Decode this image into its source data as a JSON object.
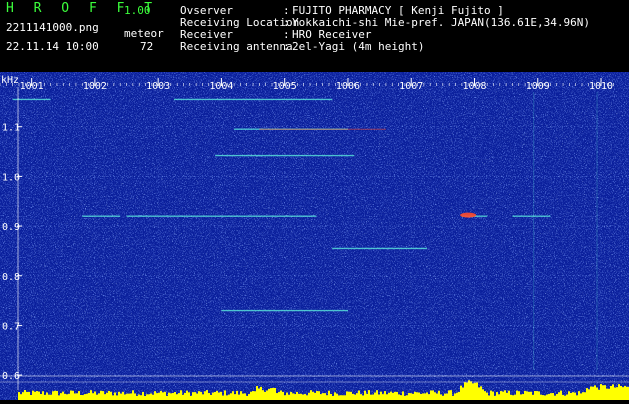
{
  "header": {
    "app_title": "H R O F F T",
    "version": "1.00",
    "filename": "2211141000.png",
    "datetime": "22.11.14 10:00",
    "meteor_label": "meteor",
    "meteor_count": "72",
    "fields": [
      {
        "label": "Ovserver",
        "value": "FUJITO PHARMACY [ Kenji Fujito ]"
      },
      {
        "label": "Receiving Location",
        "value": "Yokkaichi-shi Mie-pref. JAPAN(136.61E,34.96N)"
      },
      {
        "label": "Receiver",
        "value": "HRO Receiver"
      },
      {
        "label": "Receiving antenna",
        "value": "2el-Yagi (4m height)"
      }
    ],
    "separator": ":"
  },
  "colors": {
    "background": "#000000",
    "plot_background": "#0a1f9c",
    "header_green": "#3cff3c",
    "echo_cyan": "#5ff5e0",
    "echo_red": "#ff4a2a",
    "noise_yellow": "#ffff00"
  },
  "chart_data": {
    "type": "heatmap",
    "ylabel": "kHz",
    "x_ticks": [
      "1001",
      "1002",
      "1003",
      "1004",
      "1005",
      "1006",
      "1007",
      "1008",
      "1009",
      "1010"
    ],
    "y_ticks": [
      "1.1",
      "1.0",
      "0.9",
      "0.8",
      "0.7",
      "0.6"
    ],
    "y_values": [
      1.1,
      1.0,
      0.9,
      0.8,
      0.7,
      0.6
    ],
    "ylim": [
      0.57,
      1.18
    ],
    "xlim": [
      1000.5,
      1010.3
    ],
    "echoes": [
      {
        "minute": 1001.0,
        "freq": 1.155,
        "span": 0.6
      },
      {
        "minute": 1004.5,
        "freq": 1.155,
        "span": 2.5
      },
      {
        "minute": 1005.1,
        "freq": 1.095,
        "span": 1.8
      },
      {
        "minute": 1005.0,
        "freq": 1.042,
        "span": 2.2
      },
      {
        "minute": 1002.1,
        "freq": 0.92,
        "span": 0.6
      },
      {
        "minute": 1004.0,
        "freq": 0.92,
        "span": 3.0
      },
      {
        "minute": 1008.0,
        "freq": 0.92,
        "span": 0.4
      },
      {
        "minute": 1008.9,
        "freq": 0.92,
        "span": 0.6
      },
      {
        "minute": 1006.5,
        "freq": 0.855,
        "span": 1.5
      },
      {
        "minute": 1005.0,
        "freq": 0.73,
        "span": 2.0
      }
    ]
  }
}
